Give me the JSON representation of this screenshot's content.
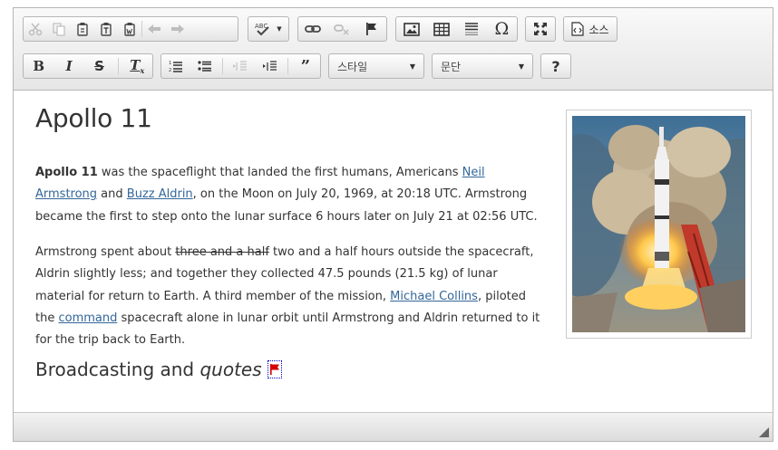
{
  "toolbar": {
    "row1": [
      {
        "name": "cut-icon",
        "glyph": "✂",
        "disabled": true
      },
      {
        "name": "copy-icon",
        "glyph": "⎘",
        "disabled": true
      },
      {
        "name": "paste-icon",
        "glyph": "📋",
        "disabled": false
      },
      {
        "name": "paste-text-icon",
        "glyph": "📋",
        "disabled": false
      },
      {
        "name": "paste-from-word-icon",
        "glyph": "📋",
        "disabled": false
      },
      {
        "name": "undo-icon",
        "glyph": "↶",
        "disabled": true
      },
      {
        "name": "redo-icon",
        "glyph": "↷",
        "disabled": true
      }
    ],
    "spellcheck_glyph": "ABC✓",
    "source_label": "소스"
  },
  "combos": {
    "style_label": "스타일",
    "format_label": "문단"
  },
  "help_label": "?",
  "article": {
    "title": "Apollo 11",
    "p1": {
      "lead_bold": "Apollo 11",
      "t1": " was the spaceflight that landed the first humans, Americans ",
      "link1": "Neil Armstrong",
      "t2": " and ",
      "link2": "Buzz Aldrin",
      "t3": ", on the Moon on July 20, 1969, at 20:18 UTC. Armstrong became the first to step onto the lunar surface 6 hours later on July 21 at 02:56 UTC."
    },
    "p2": {
      "t1": "Armstrong spent about ",
      "strike": "three and a half",
      "t2": " two and a half hours outside the spacecraft, Aldrin slightly less; and together they collected 47.5 pounds (21.5 kg) of lunar material for return to Earth. A third member of the mission, ",
      "link1": "Michael Collins",
      "t3": ", piloted the ",
      "link2": "command",
      "t4": " spacecraft alone in lunar orbit until Armstrong and Aldrin returned to it for the trip back to Earth."
    },
    "h2_plain": "Broadcasting and ",
    "h2_italic": "quotes"
  },
  "colors": {
    "link": "#336699",
    "anchor_flag": "#d40000"
  }
}
